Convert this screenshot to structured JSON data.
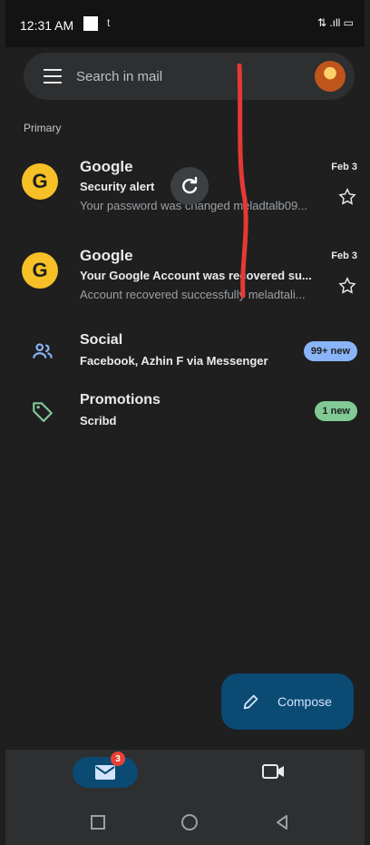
{
  "status": {
    "time": "12:31 AM",
    "mini": "t",
    "right": "⇅ .ıll ▭"
  },
  "search": {
    "placeholder": "Search in mail"
  },
  "inbox": {
    "section_label": "Primary"
  },
  "emails": [
    {
      "sender": "Google",
      "subject": "Security alert",
      "snippet": "Your password was changed meladtalb09...",
      "date": "Feb 3",
      "avatar_letter": "G"
    },
    {
      "sender": "Google",
      "subject": "Your Google Account was recovered su...",
      "snippet": "Account recovered successfully meladtali...",
      "date": "Feb 3",
      "avatar_letter": "G"
    }
  ],
  "categories": [
    {
      "title": "Social",
      "subtitle": "Facebook, Azhin F via Messenger",
      "badge": "99+ new",
      "icon": "people-icon",
      "badge_color": "#8ab4f8"
    },
    {
      "title": "Promotions",
      "subtitle": "Scribd",
      "badge": "1 new",
      "icon": "tag-icon",
      "badge_color": "#81c995"
    }
  ],
  "compose": {
    "label": "Compose"
  },
  "bottom_nav": {
    "mail_badge": "3"
  }
}
